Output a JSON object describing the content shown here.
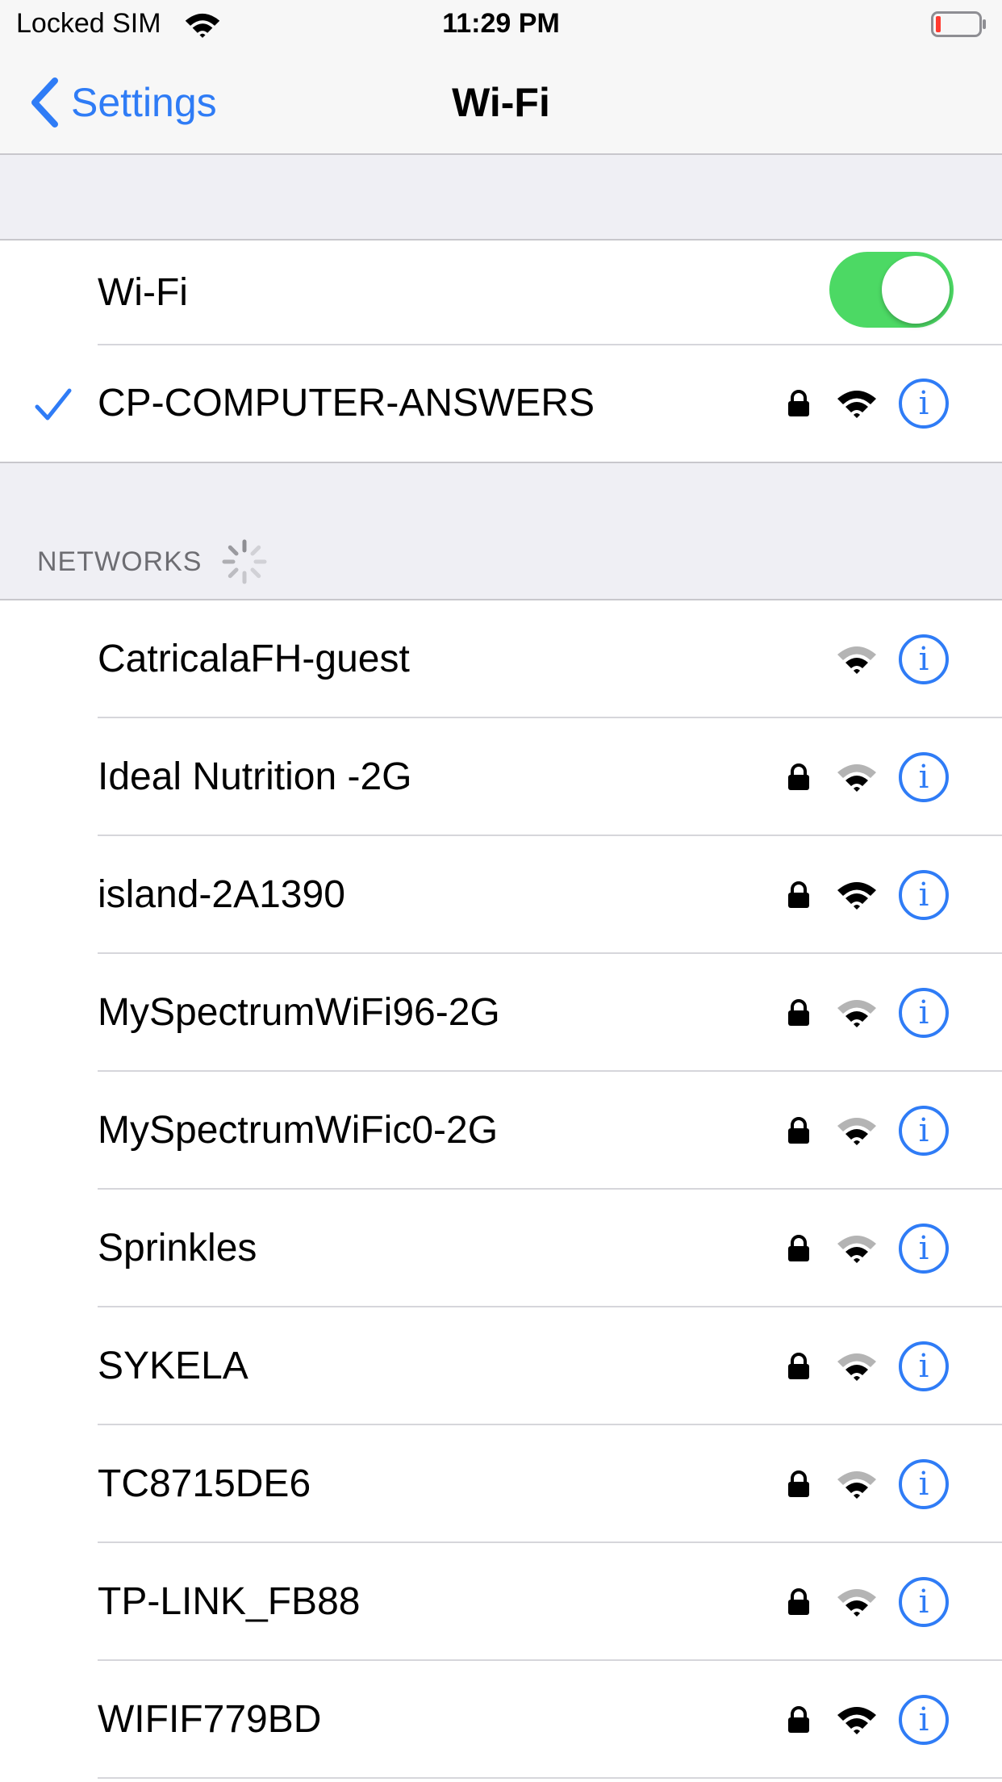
{
  "status_bar": {
    "carrier": "Locked SIM",
    "time": "11:29 PM",
    "battery_color": "#ff3b30"
  },
  "nav": {
    "back_label": "Settings",
    "title": "Wi-Fi",
    "accent_color": "#2f7cf6"
  },
  "wifi_toggle": {
    "label": "Wi-Fi",
    "on": true,
    "on_color": "#4cd964"
  },
  "connected": {
    "name": "CP-COMPUTER-ANSWERS",
    "secured": true,
    "signal": "full",
    "icons": [
      "checkmark-icon",
      "lock-icon",
      "wifi-signal-icon",
      "info-icon"
    ]
  },
  "networks_section": {
    "header": "NETWORKS",
    "loading": true
  },
  "networks": [
    {
      "name": "CatricalaFH-guest",
      "secured": false,
      "signal": "medium"
    },
    {
      "name": "Ideal Nutrition -2G",
      "secured": true,
      "signal": "medium"
    },
    {
      "name": "island-2A1390",
      "secured": true,
      "signal": "full"
    },
    {
      "name": "MySpectrumWiFi96-2G",
      "secured": true,
      "signal": "medium"
    },
    {
      "name": "MySpectrumWiFic0-2G",
      "secured": true,
      "signal": "medium"
    },
    {
      "name": "Sprinkles",
      "secured": true,
      "signal": "medium"
    },
    {
      "name": "SYKELA",
      "secured": true,
      "signal": "medium"
    },
    {
      "name": "TC8715DE6",
      "secured": true,
      "signal": "medium"
    },
    {
      "name": "TP-LINK_FB88",
      "secured": true,
      "signal": "medium"
    },
    {
      "name": "WIFIF779BD",
      "secured": true,
      "signal": "full"
    }
  ],
  "info_glyph": "i"
}
